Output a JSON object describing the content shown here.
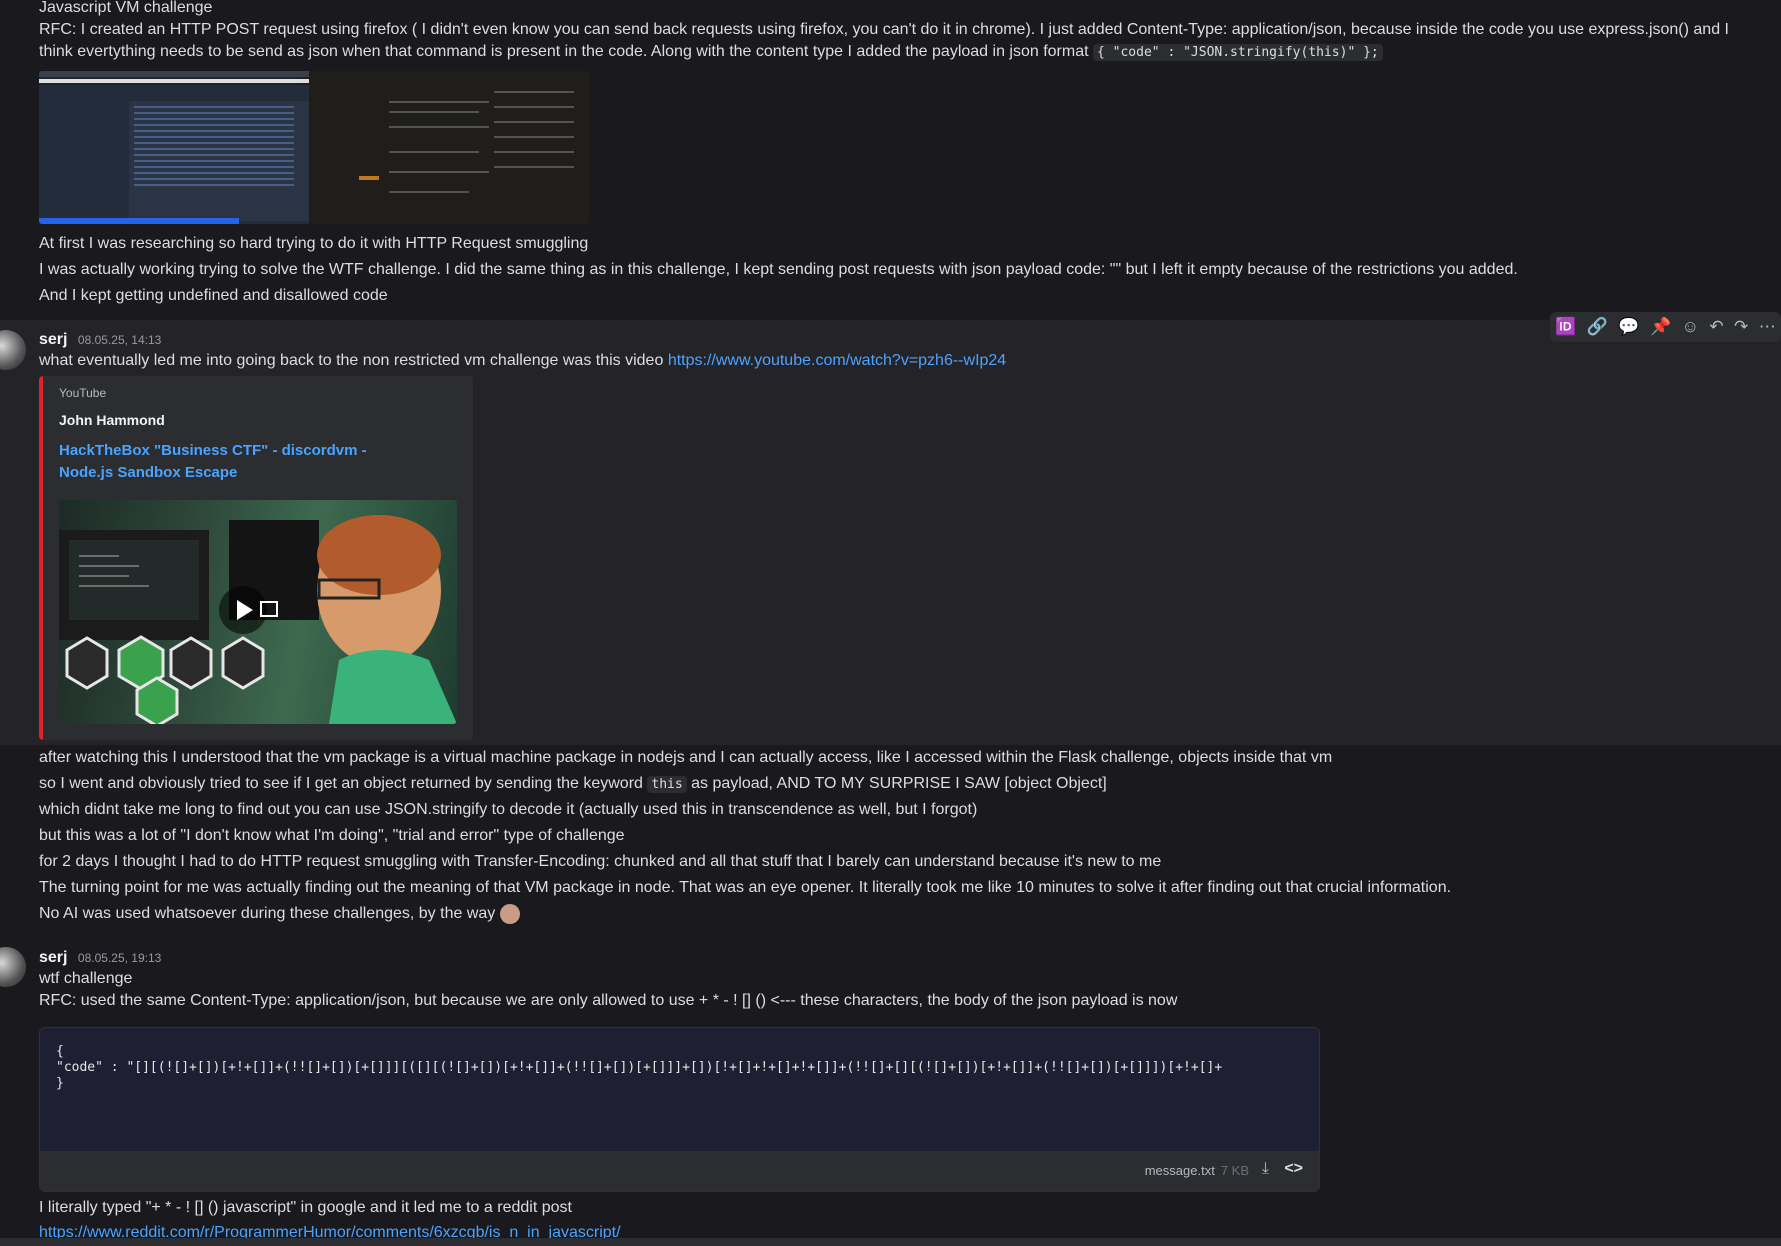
{
  "message_top": {
    "title_line": "Javascript VM challenge",
    "rfc_line": "RFC: I created an HTTP POST request using firefox ( I didn't even know you can send back requests using firefox, you can't do it in chrome). I just added Content-Type: application/json, because inside the code you use express.json() and I think evertything needs to be send as json when that command is present in the code. Along with the content type I added the payload in json format",
    "rfc_code": "{ \"code\" : \"JSON.stringify(this)\" };",
    "line2": "At first I was researching so hard trying to do it with HTTP Request smuggling",
    "line3": "I was actually working trying to solve the WTF challenge. I did the same thing as in this challenge, I kept sending post requests with json payload code: \"\" but I left it empty because of the restrictions you added.",
    "line4": "And I kept getting undefined and disallowed code"
  },
  "message_2": {
    "author": "serj",
    "timestamp": "08.05.25, 14:13",
    "text": "what eventually led me into going back to the non restricted vm challenge was this video",
    "link": "https://www.youtube.com/watch?v=pzh6--wIp24",
    "embed": {
      "provider": "YouTube",
      "author": "John Hammond",
      "title": "HackTheBox \"Business CTF\" - discordvm - Node.js Sandbox Escape",
      "accent_color": "#e0222d"
    }
  },
  "message_2_cont": {
    "l1": "after watching this I understood that the vm package is a virtual machine package in nodejs and I can actually access, like I accessed within the Flask challenge, objects inside that vm",
    "l2a": "so I went and obviously tried to see if I get an object returned by sending the keyword",
    "l2code": "this",
    "l2b": "as payload, AND TO MY SURPRISE I SAW [object Object]",
    "l3": "which didnt take me long to find out you can use JSON.stringify to decode it (actually used this in transcendence as well, but I forgot)",
    "l4": "but this was a lot of \"I don't know what I'm doing\", \"trial and error\" type of challenge",
    "l5": "for 2 days I thought I had to do HTTP request smuggling with Transfer-Encoding: chunked and all that stuff that I barely can understand because it's new to me",
    "l6": "The turning point for me was actually finding out the meaning of that VM package in node. That was an eye opener. It literally took me like 10 minutes to solve it after finding out that crucial information.",
    "l7": "No AI was used whatsoever during these challenges, by the way"
  },
  "message_3": {
    "author": "serj",
    "timestamp": "08.05.25, 19:13",
    "l1": "wtf challenge",
    "l2": "RFC: used the same Content-Type: application/json, but because we are only allowed to use + * - ! [] () <--- these characters, the body of the json payload is now",
    "code_lines": [
      "{",
      "\"code\" : \"[][(![]+[])[+!+[]]+(!![]+[])[+[]]][([][(![]+[])[+!+[]]+(!![]+[])[+[]]]+[])[!+[]+!+[]+!+[]]+(!![]+[][(![]+[])[+!+[]]+(!![]+[])[+[]]])[+!+[]+",
      "}"
    ],
    "file_name": "message.txt",
    "file_size": "7 KB",
    "after1": "I literally typed \"+ * - ! [] () javascript\" in google and it led me to a reddit post",
    "after_link": "https://www.reddit.com/r/ProgrammerHumor/comments/6xzcgb/is_n_in_javascript/"
  },
  "toolbar": {
    "icons": [
      "id-icon",
      "link-icon",
      "thread-icon",
      "pin-icon",
      "emoji-icon",
      "reply-icon",
      "forward-icon",
      "more-icon"
    ]
  }
}
